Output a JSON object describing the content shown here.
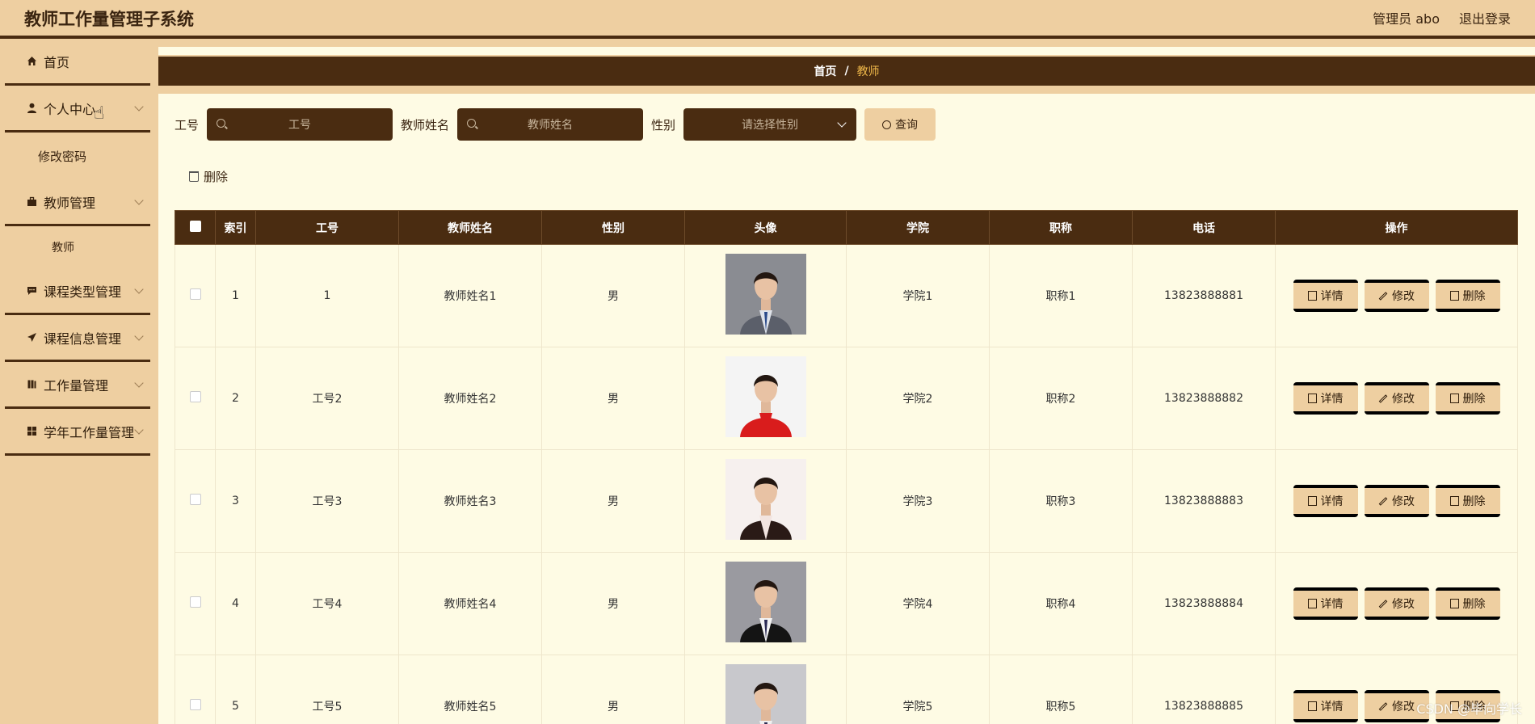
{
  "header": {
    "title": "教师工作量管理子系统",
    "user": "管理员 abo",
    "logout": "退出登录"
  },
  "sidebar": {
    "items": [
      {
        "label": "首页",
        "icon": "home-icon"
      },
      {
        "label": "个人中心",
        "icon": "user-icon",
        "sub": [
          "修改密码"
        ]
      },
      {
        "label": "教师管理",
        "icon": "briefcase-icon",
        "sub": [
          "教师"
        ]
      },
      {
        "label": "课程类型管理",
        "icon": "chat-icon"
      },
      {
        "label": "课程信息管理",
        "icon": "send-icon"
      },
      {
        "label": "工作量管理",
        "icon": "book-icon"
      },
      {
        "label": "学年工作量管理",
        "icon": "grid-icon"
      }
    ]
  },
  "breadcrumb": {
    "home": "首页",
    "sep": "/",
    "current": "教师"
  },
  "search": {
    "field1_label": "工号",
    "field1_placeholder": "工号",
    "field2_label": "教师姓名",
    "field2_placeholder": "教师姓名",
    "field3_label": "性别",
    "field3_placeholder": "请选择性别",
    "query_label": "查询"
  },
  "toolbar": {
    "delete_label": "删除"
  },
  "table": {
    "headers": [
      "索引",
      "工号",
      "教师姓名",
      "性别",
      "头像",
      "学院",
      "职称",
      "电话",
      "操作"
    ],
    "rows": [
      {
        "index": "1",
        "id": "1",
        "name": "教师姓名1",
        "gender": "男",
        "college": "学院1",
        "title": "职称1",
        "phone": "13823888881"
      },
      {
        "index": "2",
        "id": "工号2",
        "name": "教师姓名2",
        "gender": "男",
        "college": "学院2",
        "title": "职称2",
        "phone": "13823888882"
      },
      {
        "index": "3",
        "id": "工号3",
        "name": "教师姓名3",
        "gender": "男",
        "college": "学院3",
        "title": "职称3",
        "phone": "13823888883"
      },
      {
        "index": "4",
        "id": "工号4",
        "name": "教师姓名4",
        "gender": "男",
        "college": "学院4",
        "title": "职称4",
        "phone": "13823888884"
      },
      {
        "index": "5",
        "id": "工号5",
        "name": "教师姓名5",
        "gender": "男",
        "college": "学院5",
        "title": "职称5",
        "phone": "13823888885"
      }
    ],
    "actions": {
      "detail": "详情",
      "edit": "修改",
      "delete": "删除"
    }
  },
  "watermark": "CSDN @毕向学长",
  "colors": {
    "header_bg": "#eecfa1",
    "dark_brown": "#4a2c11",
    "page_bg": "#fefbe4",
    "breadcrumb_active": "#f0b94a"
  }
}
